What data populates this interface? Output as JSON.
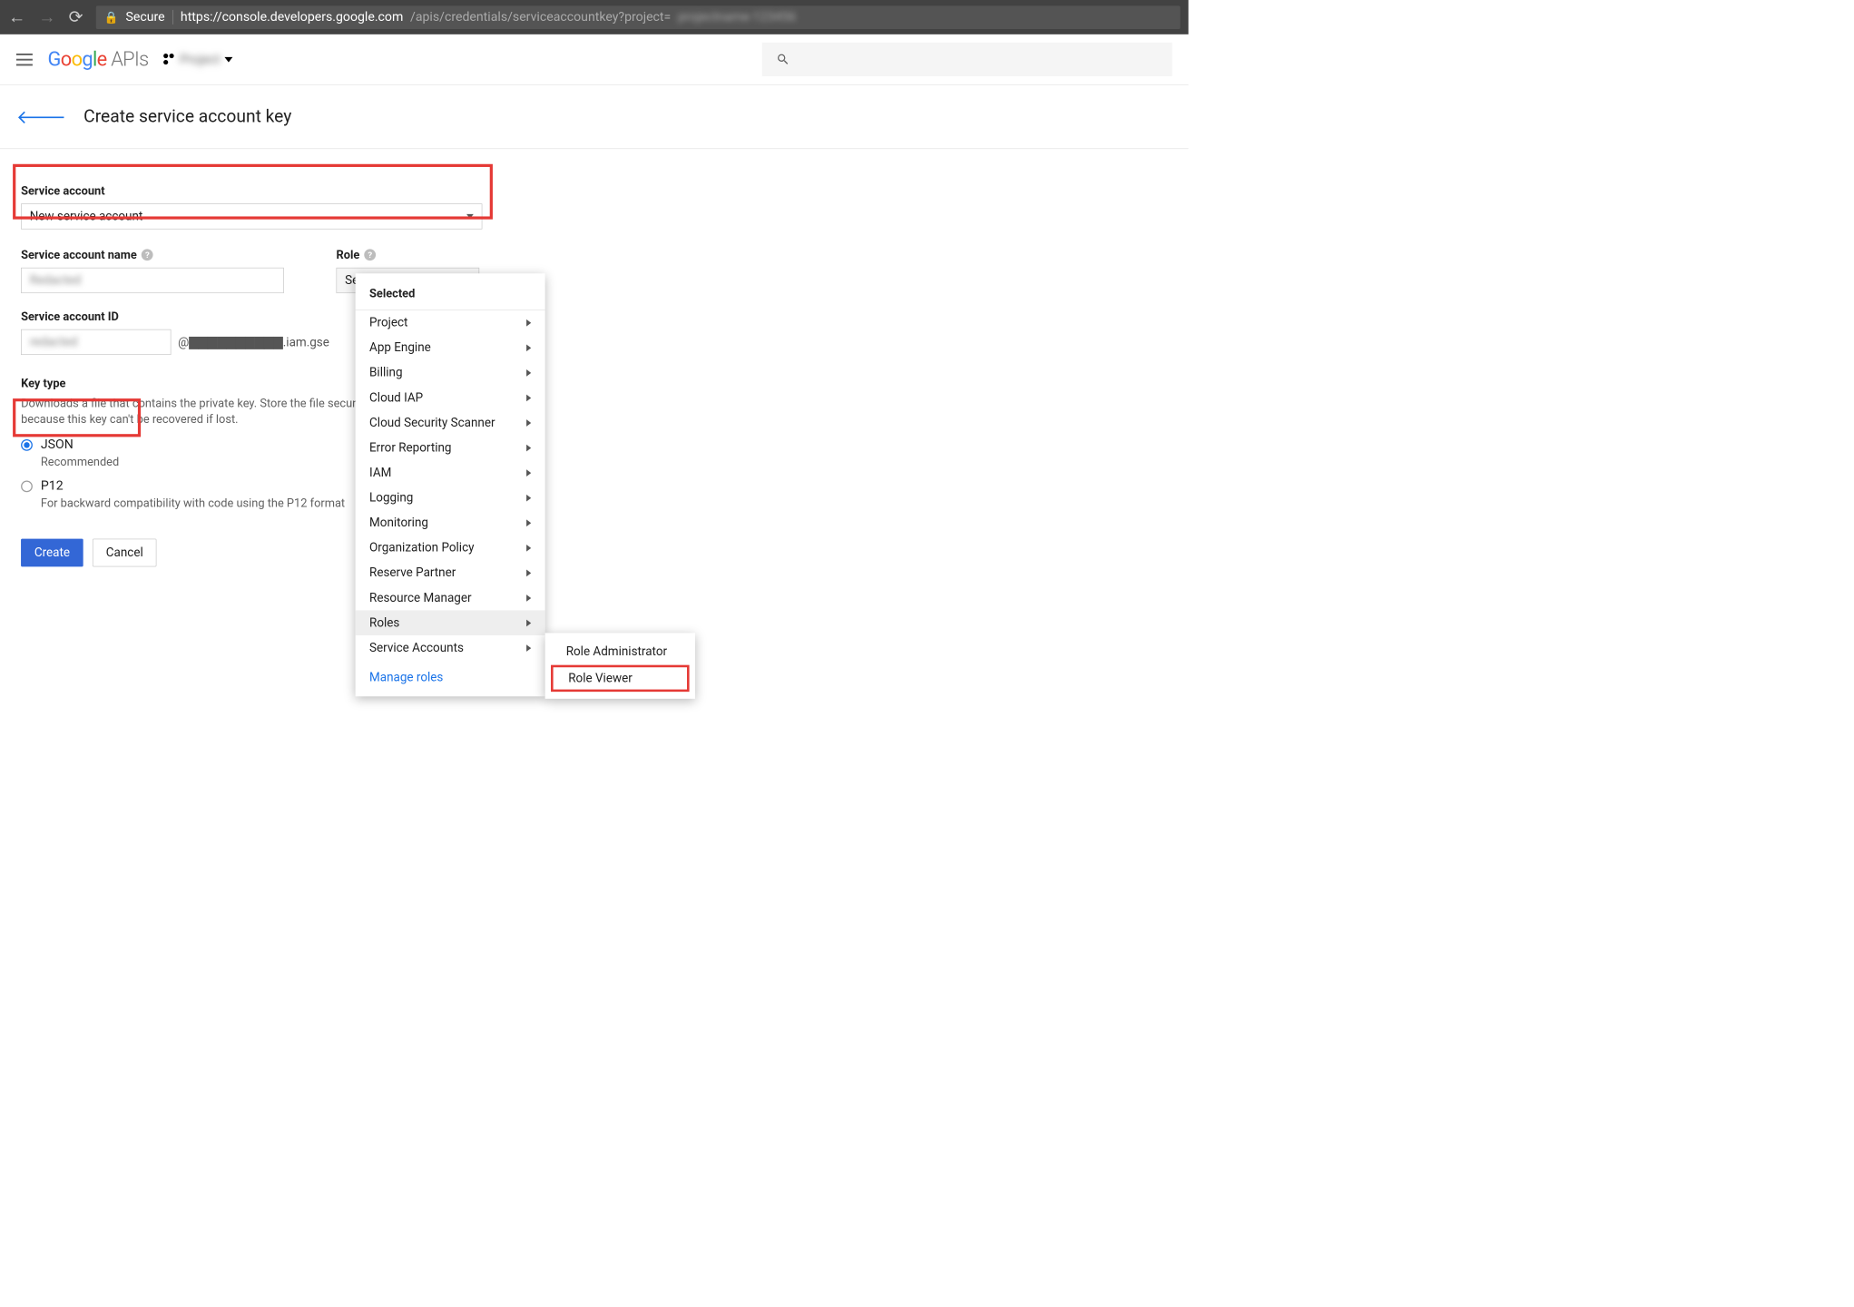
{
  "browser": {
    "secure_label": "Secure",
    "url_secure": "https://console.developers.google.com",
    "url_path": "/apis/credentials/serviceaccountkey?project="
  },
  "header": {
    "logo_apis": " APIs",
    "project_name": "Project"
  },
  "page": {
    "title": "Create service account key"
  },
  "form": {
    "sa_label": "Service account",
    "sa_value": "New service account",
    "name_label": "Service account name",
    "name_value": "Redacted",
    "role_label": "Role",
    "role_value": "Select a role",
    "id_label": "Service account ID",
    "id_value": "redacted",
    "id_suffix": "@▇▇▇▇▇▇▇▇▇▇.iam.gse",
    "keytype_label": "Key type",
    "keytype_desc": "Downloads a file that contains the private key. Store the file securely because this key can't be recovered if lost.",
    "json_label": "JSON",
    "json_sub": "Recommended",
    "p12_label": "P12",
    "p12_sub": "For backward compatibility with code using the P12 format",
    "create_btn": "Create",
    "cancel_btn": "Cancel"
  },
  "rolemenu": {
    "heading": "Selected",
    "items": [
      "Project",
      "App Engine",
      "Billing",
      "Cloud IAP",
      "Cloud Security Scanner",
      "Error Reporting",
      "IAM",
      "Logging",
      "Monitoring",
      "Organization Policy",
      "Reserve Partner",
      "Resource Manager",
      "Roles",
      "Service Accounts"
    ],
    "hovered_index": 12,
    "manage": "Manage roles"
  },
  "submenu": {
    "items": [
      "Role Administrator",
      "Role Viewer"
    ],
    "boxed_index": 1
  }
}
